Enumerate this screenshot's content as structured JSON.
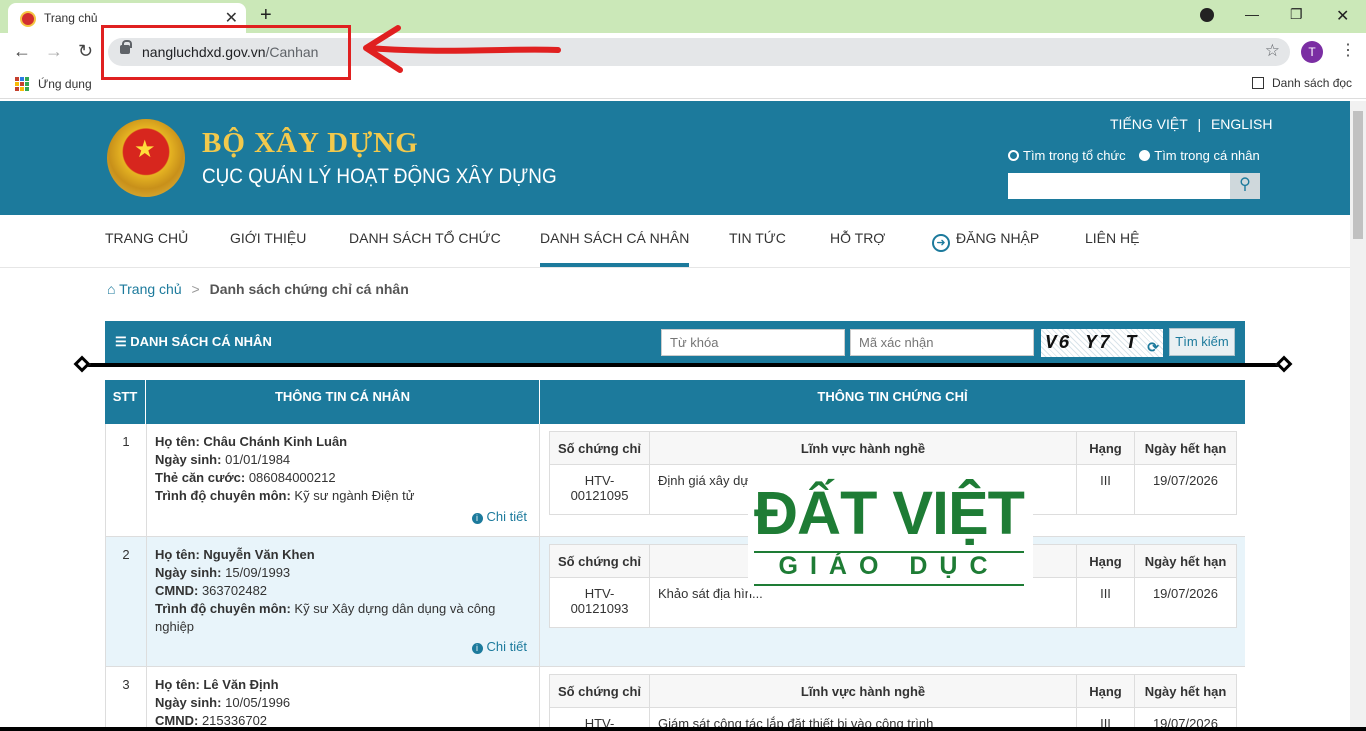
{
  "browser": {
    "tab_title": "Trang chủ",
    "url_host": "nangluchdxd.gov.vn",
    "url_path": "/Canhan",
    "avatar_letter": "T",
    "bookmarks_apps": "Ứng dụng",
    "reading_list": "Danh sách đọc"
  },
  "site": {
    "brand_title": "BỘ XÂY DỰNG",
    "brand_subtitle": "CỤC QUẢN LÝ HOẠT ĐỘNG XÂY DỰNG",
    "lang_vi": "TIẾNG VIỆT",
    "lang_sep": "|",
    "lang_en": "ENGLISH",
    "radio_org": "Tìm trong tổ chức",
    "radio_person": "Tìm trong cá nhân"
  },
  "menu": {
    "items": [
      "TRANG CHỦ",
      "GIỚI THIỆU",
      "DANH SÁCH TỔ CHỨC",
      "DANH SÁCH CÁ NHÂN",
      "TIN TỨC",
      "HỖ TRỢ",
      "ĐĂNG NHẬP",
      "LIÊN HỆ"
    ],
    "active_index": 3
  },
  "breadcrumb": {
    "home": "Trang chủ",
    "sep": ">",
    "current": "Danh sách chứng chỉ cá nhân"
  },
  "panel": {
    "title": "DANH SÁCH CÁ NHÂN",
    "keyword_placeholder": "Từ khóa",
    "captcha_placeholder": "Mã xác nhận",
    "captcha_text": "V6 Y7 T",
    "search_button": "Tìm kiếm"
  },
  "table": {
    "col_stt": "STT",
    "col_info": "THÔNG TIN CÁ NHÂN",
    "col_cert": "THÔNG TIN CHỨNG CHỈ",
    "sub_headers": [
      "Số chứng chỉ",
      "Lĩnh vực hành nghề",
      "Hạng",
      "Ngày hết hạn"
    ],
    "detail_label": "Chi tiết",
    "rows": [
      {
        "stt": "1",
        "name_label": "Họ tên:",
        "name": "Châu Chánh Kinh Luân",
        "dob_label": "Ngày sinh:",
        "dob": "01/01/1984",
        "id_label": "Thẻ căn cước:",
        "id": "086084000212",
        "level_label": "Trình độ chuyên môn:",
        "level": "Kỹ sư ngành Điện tử",
        "cert_no": "HTV-00121095",
        "field": "Định giá xây dự...",
        "grade": "III",
        "expiry": "19/07/2026"
      },
      {
        "stt": "2",
        "name_label": "Họ tên:",
        "name": "Nguyễn Văn Khen",
        "dob_label": "Ngày sinh:",
        "dob": "15/09/1993",
        "id_label": "CMND:",
        "id": "363702482",
        "level_label": "Trình độ chuyên môn:",
        "level": "Kỹ sư Xây dựng dân dụng và công nghiệp",
        "cert_no": "HTV-00121093",
        "field": "Khảo sát địa hìn...",
        "grade": "III",
        "expiry": "19/07/2026"
      },
      {
        "stt": "3",
        "name_label": "Họ tên:",
        "name": "Lê Văn Định",
        "dob_label": "Ngày sinh:",
        "dob": "10/05/1996",
        "id_label": "CMND:",
        "id": "215336702",
        "level_label": "",
        "level": "",
        "cert_no": "HTV-",
        "field": "Giám sát công tác lắp đặt thiết bị vào công trình",
        "grade": "III",
        "expiry": "19/07/2026"
      }
    ]
  },
  "watermark": {
    "line1": "ĐẤT VIỆT",
    "line2": "GIÁO DỤC"
  },
  "colors": {
    "primary": "#1c7a9c",
    "annotation": "#e02020",
    "watermark": "#1e7c35"
  }
}
